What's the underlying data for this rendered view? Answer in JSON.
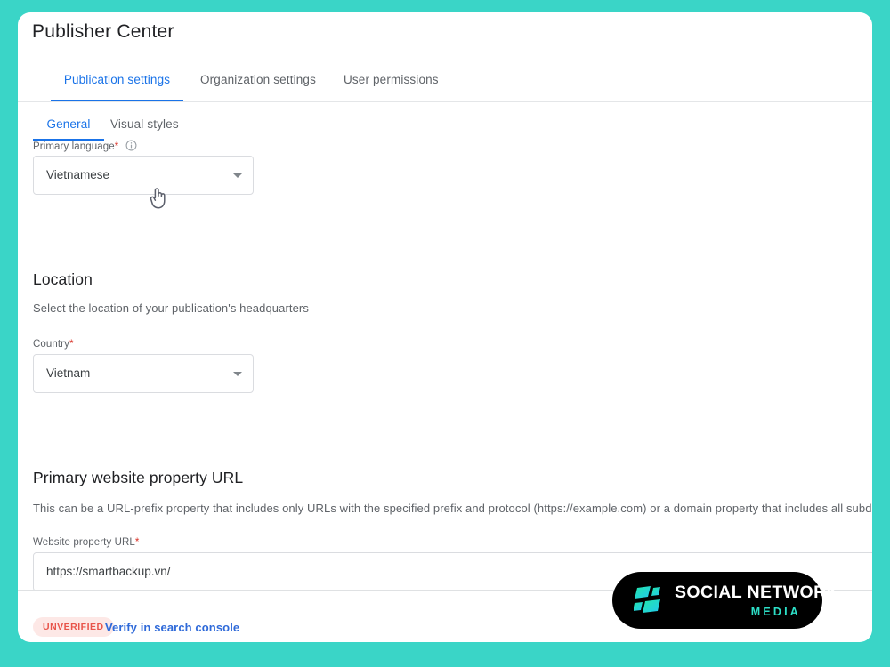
{
  "theme": {
    "page_background": "#3ad5c7",
    "card_background": "#ffffff",
    "accent_blue": "#1a73e8",
    "required_red": "#d93025",
    "badge_background": "#fde8e6",
    "badge_text": "#e8544a",
    "link_blue": "#2f6ad9",
    "watermark_background": "#000000",
    "watermark_accent": "#2de0c8"
  },
  "header": {
    "title": "Publisher Center"
  },
  "primary_tabs": [
    {
      "label": "Publication settings",
      "active": true
    },
    {
      "label": "Organization settings",
      "active": false
    },
    {
      "label": "User permissions",
      "active": false
    }
  ],
  "secondary_tabs": [
    {
      "label": "General",
      "active": true
    },
    {
      "label": "Visual styles",
      "active": false
    }
  ],
  "language_section": {
    "label": "Primary language",
    "required_marker": "*",
    "info_icon": "info-icon",
    "select_value": "Vietnamese",
    "caret_icon": "chevron-down-icon"
  },
  "location_section": {
    "heading": "Location",
    "description": "Select the location of your publication's headquarters",
    "country_label": "Country",
    "required_marker": "*",
    "country_value": "Vietnam",
    "caret_icon": "chevron-down-icon"
  },
  "url_section": {
    "heading": "Primary website property URL",
    "description": "This can be a URL-prefix property that includes only URLs with the specified prefix and protocol (https://example.com) or a domain property that includes all subdomains and",
    "url_label": "Website property URL",
    "required_marker": "*",
    "url_value": "https://smartbackup.vn/",
    "status_badge": "UNVERIFIED",
    "verify_link": "Verify in search console"
  },
  "cursor": {
    "icon": "pointing-hand-cursor"
  },
  "watermark": {
    "primary_text": "SOCIAL NETWORK",
    "secondary_text": "MEDIA",
    "logo_icon": "social-network-media-logo"
  }
}
